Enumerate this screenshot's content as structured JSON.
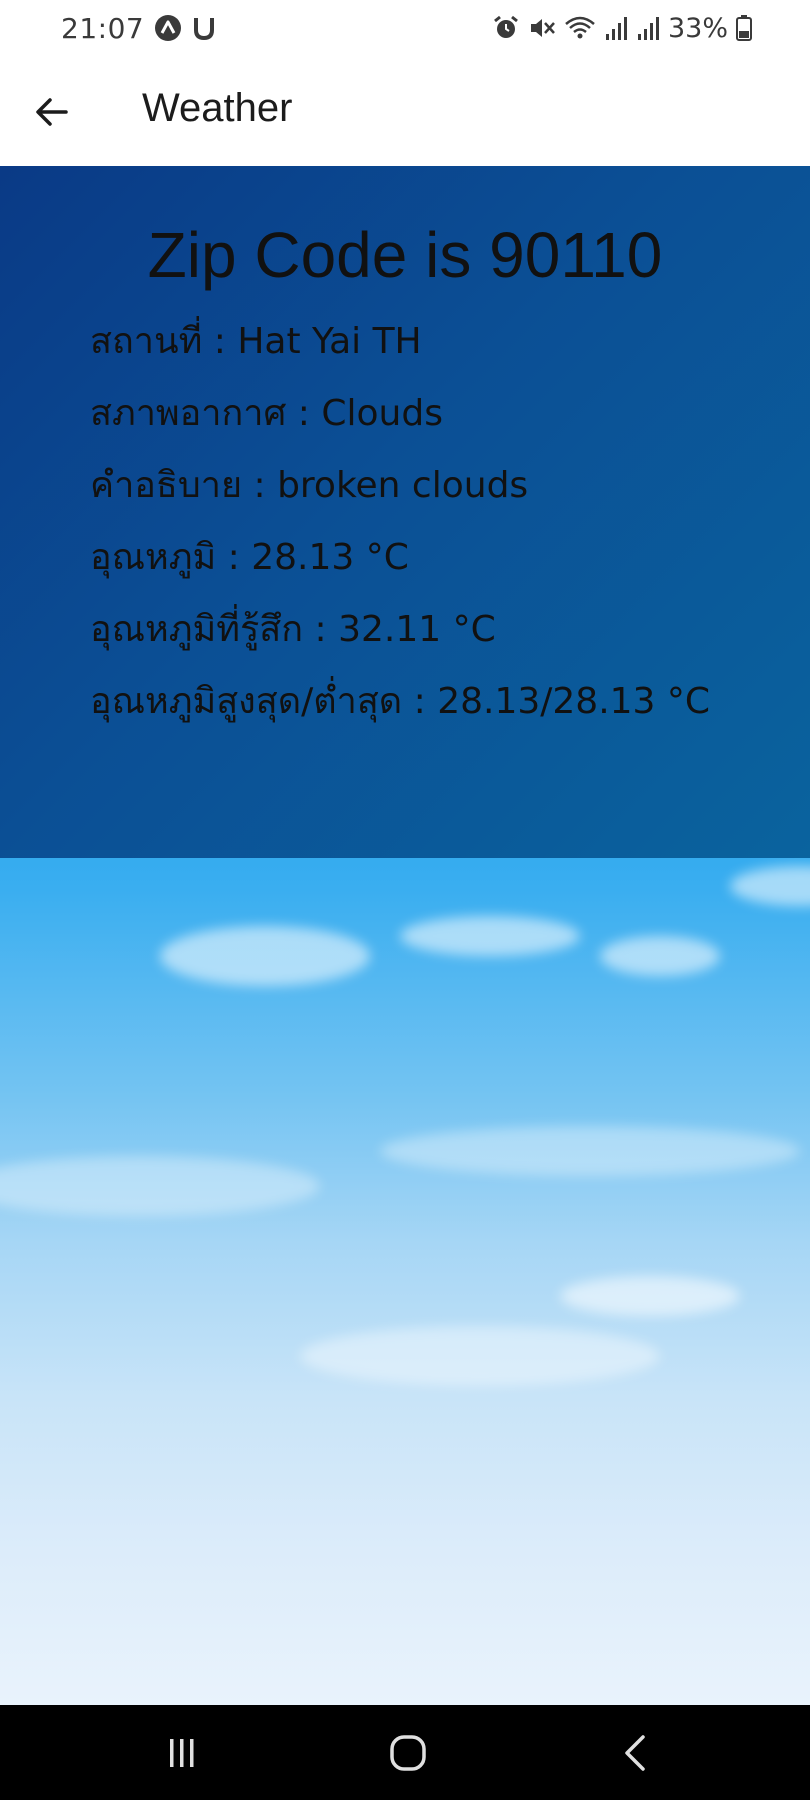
{
  "status_bar": {
    "time": "21:07",
    "battery_percent": "33%",
    "left_icons": [
      "nav-app-icon",
      "u-icon"
    ],
    "right_icons": [
      "alarm-icon",
      "mute-icon",
      "wifi-icon",
      "signal-icon",
      "signal-icon",
      "battery-icon"
    ]
  },
  "app_bar": {
    "title": "Weather",
    "back_icon": "arrow-left-icon"
  },
  "weather": {
    "zip_title": "Zip Code is 90110",
    "rows": [
      "สถานที่ : Hat Yai TH",
      "สภาพอากาศ : Clouds",
      "คำอธิบาย : broken clouds",
      "อุณหภูมิ : 28.13 °C",
      "อุณหภูมิที่รู้สึก : 32.11 °C",
      "อุณหภูมิสูงสุด/ต่ำสุด : 28.13/28.13 °C"
    ]
  },
  "nav_bar": {
    "icons": [
      "recents-icon",
      "home-icon",
      "back-icon"
    ]
  },
  "colors": {
    "panel": "#0b4f95",
    "sky_top": "#0a7fd8",
    "sky_bottom": "#e9f3fc",
    "nav_bar": "#000000"
  }
}
